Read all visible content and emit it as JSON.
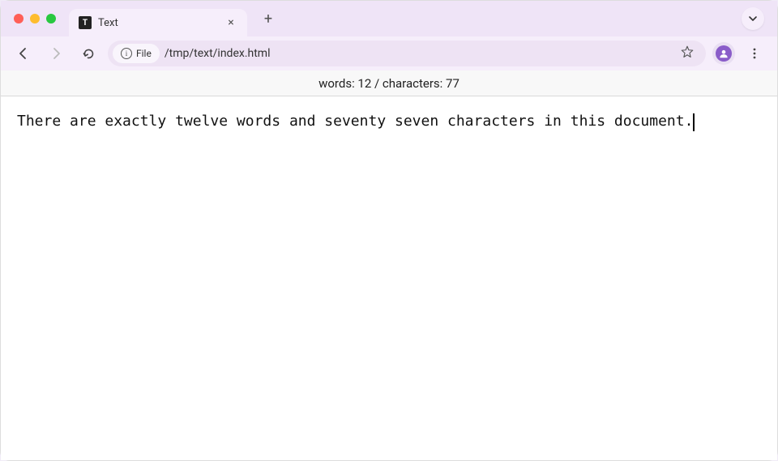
{
  "browser": {
    "tab": {
      "title": "Text",
      "favicon_letter": "T"
    },
    "nav": {
      "back_enabled": true,
      "forward_enabled": false
    },
    "address": {
      "scheme_label": "File",
      "path": "/tmp/text/index.html"
    }
  },
  "stats": {
    "text": "words: 12 / characters: 77",
    "words": 12,
    "characters": 77
  },
  "editor": {
    "text": "There are exactly twelve words and seventy seven characters in this document."
  }
}
